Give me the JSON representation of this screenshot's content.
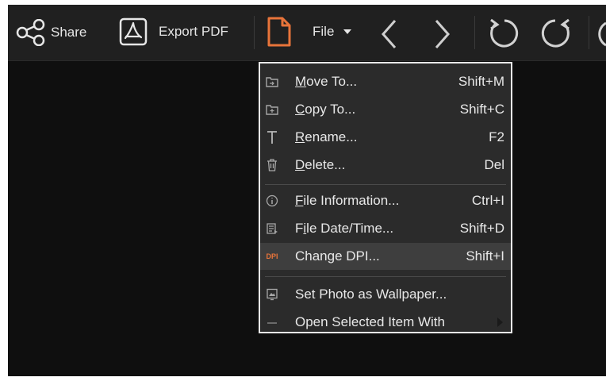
{
  "toolbar": {
    "share_label": "Share",
    "export_pdf_label": "Export PDF",
    "file_label": "File",
    "accent": "#e8743a"
  },
  "menu": {
    "items": [
      {
        "pre": "",
        "ul": "M",
        "post": "ove To...",
        "shortcut": "Shift+M",
        "icon": "folder-move-icon"
      },
      {
        "pre": "",
        "ul": "C",
        "post": "opy To...",
        "shortcut": "Shift+C",
        "icon": "folder-copy-icon"
      },
      {
        "pre": "",
        "ul": "R",
        "post": "ename...",
        "shortcut": "F2",
        "icon": "rename-icon"
      },
      {
        "pre": "",
        "ul": "D",
        "post": "elete...",
        "shortcut": "Del",
        "icon": "trash-icon"
      },
      {
        "pre": "",
        "ul": "F",
        "post": "ile Information...",
        "shortcut": "Ctrl+I",
        "icon": "info-icon"
      },
      {
        "pre": "F",
        "ul": "i",
        "post": "le Date/Time...",
        "shortcut": "Shift+D",
        "icon": "file-date-icon"
      },
      {
        "pre": "",
        "ul": "",
        "post": "Change DPI...",
        "shortcut": "Shift+I",
        "icon": "dpi-icon",
        "badge": "DPI"
      },
      {
        "pre": "",
        "ul": "",
        "post": "Set Photo as Wallpaper...",
        "shortcut": "",
        "icon": "wallpaper-icon"
      },
      {
        "pre": "",
        "ul": "",
        "post": "Open Selected Item With",
        "shortcut": "",
        "icon": "open-with-icon"
      }
    ]
  }
}
